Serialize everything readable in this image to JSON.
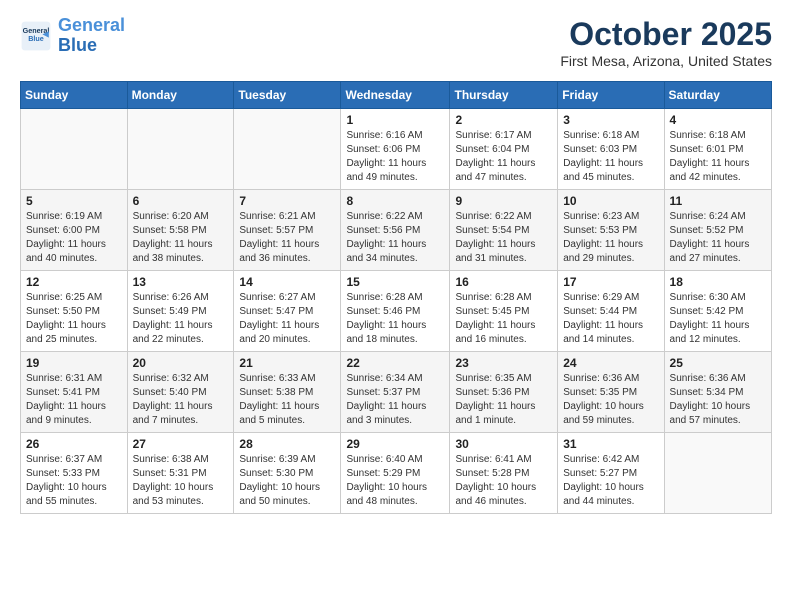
{
  "header": {
    "logo_line1": "General",
    "logo_line2": "Blue",
    "month": "October 2025",
    "location": "First Mesa, Arizona, United States"
  },
  "weekdays": [
    "Sunday",
    "Monday",
    "Tuesday",
    "Wednesday",
    "Thursday",
    "Friday",
    "Saturday"
  ],
  "weeks": [
    [
      {
        "day": "",
        "info": ""
      },
      {
        "day": "",
        "info": ""
      },
      {
        "day": "",
        "info": ""
      },
      {
        "day": "1",
        "info": "Sunrise: 6:16 AM\nSunset: 6:06 PM\nDaylight: 11 hours and 49 minutes."
      },
      {
        "day": "2",
        "info": "Sunrise: 6:17 AM\nSunset: 6:04 PM\nDaylight: 11 hours and 47 minutes."
      },
      {
        "day": "3",
        "info": "Sunrise: 6:18 AM\nSunset: 6:03 PM\nDaylight: 11 hours and 45 minutes."
      },
      {
        "day": "4",
        "info": "Sunrise: 6:18 AM\nSunset: 6:01 PM\nDaylight: 11 hours and 42 minutes."
      }
    ],
    [
      {
        "day": "5",
        "info": "Sunrise: 6:19 AM\nSunset: 6:00 PM\nDaylight: 11 hours and 40 minutes."
      },
      {
        "day": "6",
        "info": "Sunrise: 6:20 AM\nSunset: 5:58 PM\nDaylight: 11 hours and 38 minutes."
      },
      {
        "day": "7",
        "info": "Sunrise: 6:21 AM\nSunset: 5:57 PM\nDaylight: 11 hours and 36 minutes."
      },
      {
        "day": "8",
        "info": "Sunrise: 6:22 AM\nSunset: 5:56 PM\nDaylight: 11 hours and 34 minutes."
      },
      {
        "day": "9",
        "info": "Sunrise: 6:22 AM\nSunset: 5:54 PM\nDaylight: 11 hours and 31 minutes."
      },
      {
        "day": "10",
        "info": "Sunrise: 6:23 AM\nSunset: 5:53 PM\nDaylight: 11 hours and 29 minutes."
      },
      {
        "day": "11",
        "info": "Sunrise: 6:24 AM\nSunset: 5:52 PM\nDaylight: 11 hours and 27 minutes."
      }
    ],
    [
      {
        "day": "12",
        "info": "Sunrise: 6:25 AM\nSunset: 5:50 PM\nDaylight: 11 hours and 25 minutes."
      },
      {
        "day": "13",
        "info": "Sunrise: 6:26 AM\nSunset: 5:49 PM\nDaylight: 11 hours and 22 minutes."
      },
      {
        "day": "14",
        "info": "Sunrise: 6:27 AM\nSunset: 5:47 PM\nDaylight: 11 hours and 20 minutes."
      },
      {
        "day": "15",
        "info": "Sunrise: 6:28 AM\nSunset: 5:46 PM\nDaylight: 11 hours and 18 minutes."
      },
      {
        "day": "16",
        "info": "Sunrise: 6:28 AM\nSunset: 5:45 PM\nDaylight: 11 hours and 16 minutes."
      },
      {
        "day": "17",
        "info": "Sunrise: 6:29 AM\nSunset: 5:44 PM\nDaylight: 11 hours and 14 minutes."
      },
      {
        "day": "18",
        "info": "Sunrise: 6:30 AM\nSunset: 5:42 PM\nDaylight: 11 hours and 12 minutes."
      }
    ],
    [
      {
        "day": "19",
        "info": "Sunrise: 6:31 AM\nSunset: 5:41 PM\nDaylight: 11 hours and 9 minutes."
      },
      {
        "day": "20",
        "info": "Sunrise: 6:32 AM\nSunset: 5:40 PM\nDaylight: 11 hours and 7 minutes."
      },
      {
        "day": "21",
        "info": "Sunrise: 6:33 AM\nSunset: 5:38 PM\nDaylight: 11 hours and 5 minutes."
      },
      {
        "day": "22",
        "info": "Sunrise: 6:34 AM\nSunset: 5:37 PM\nDaylight: 11 hours and 3 minutes."
      },
      {
        "day": "23",
        "info": "Sunrise: 6:35 AM\nSunset: 5:36 PM\nDaylight: 11 hours and 1 minute."
      },
      {
        "day": "24",
        "info": "Sunrise: 6:36 AM\nSunset: 5:35 PM\nDaylight: 10 hours and 59 minutes."
      },
      {
        "day": "25",
        "info": "Sunrise: 6:36 AM\nSunset: 5:34 PM\nDaylight: 10 hours and 57 minutes."
      }
    ],
    [
      {
        "day": "26",
        "info": "Sunrise: 6:37 AM\nSunset: 5:33 PM\nDaylight: 10 hours and 55 minutes."
      },
      {
        "day": "27",
        "info": "Sunrise: 6:38 AM\nSunset: 5:31 PM\nDaylight: 10 hours and 53 minutes."
      },
      {
        "day": "28",
        "info": "Sunrise: 6:39 AM\nSunset: 5:30 PM\nDaylight: 10 hours and 50 minutes."
      },
      {
        "day": "29",
        "info": "Sunrise: 6:40 AM\nSunset: 5:29 PM\nDaylight: 10 hours and 48 minutes."
      },
      {
        "day": "30",
        "info": "Sunrise: 6:41 AM\nSunset: 5:28 PM\nDaylight: 10 hours and 46 minutes."
      },
      {
        "day": "31",
        "info": "Sunrise: 6:42 AM\nSunset: 5:27 PM\nDaylight: 10 hours and 44 minutes."
      },
      {
        "day": "",
        "info": ""
      }
    ]
  ]
}
